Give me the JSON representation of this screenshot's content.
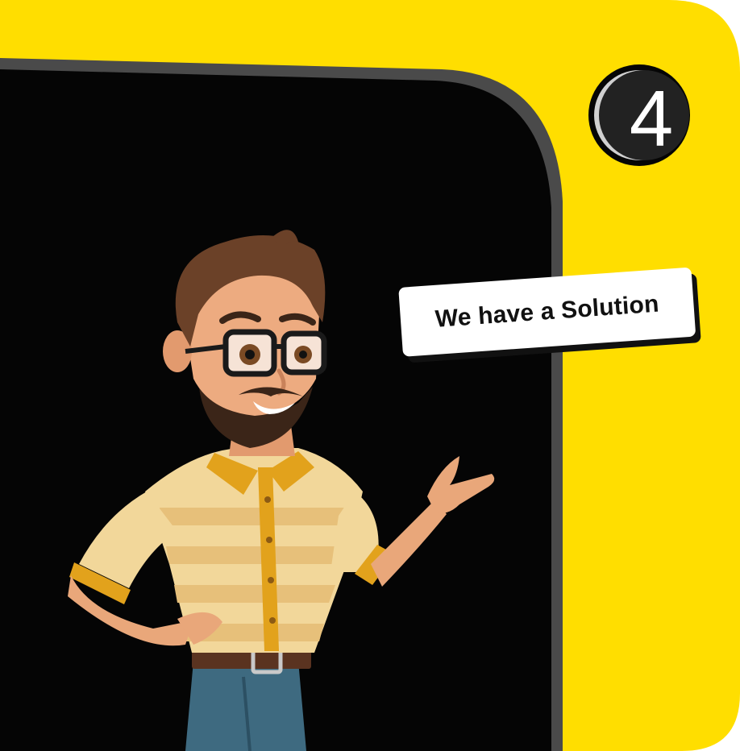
{
  "step_badge": {
    "number": "4"
  },
  "callout": {
    "text": "We have a Solution"
  },
  "colors": {
    "background": "#FFDE00",
    "panel": "#050505",
    "panel_border": "#4A4A4A",
    "badge_fill": "#222222",
    "callout_bg": "#FFFFFF",
    "callout_text": "#111111"
  },
  "illustration": {
    "subject": "cartoon man with glasses and beard pointing",
    "icon": "presenter-character-icon"
  }
}
